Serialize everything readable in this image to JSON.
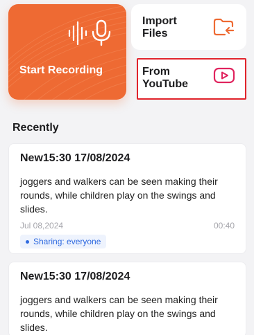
{
  "actions": {
    "record_label": "Start Recording",
    "import_label": "Import Files",
    "youtube_label": "From YouTube"
  },
  "section_title": "Recently",
  "recordings": [
    {
      "title": "New15:30 17/08/2024",
      "text": "joggers and walkers can be seen making their rounds, while children play on the swings and slides.",
      "date": "Jul 08,2024",
      "duration": "00:40",
      "sharing": "Sharing: everyone"
    },
    {
      "title": "New15:30 17/08/2024",
      "text": "joggers and walkers can be seen making their rounds, while children play on the swings and slides."
    }
  ],
  "colors": {
    "accent": "#ee6a33",
    "highlight_border": "#e1232b",
    "badge_text": "#2f6ae0"
  },
  "icons": [
    "microphone-icon",
    "waveform-icon",
    "folder-import-icon",
    "youtube-play-icon"
  ]
}
